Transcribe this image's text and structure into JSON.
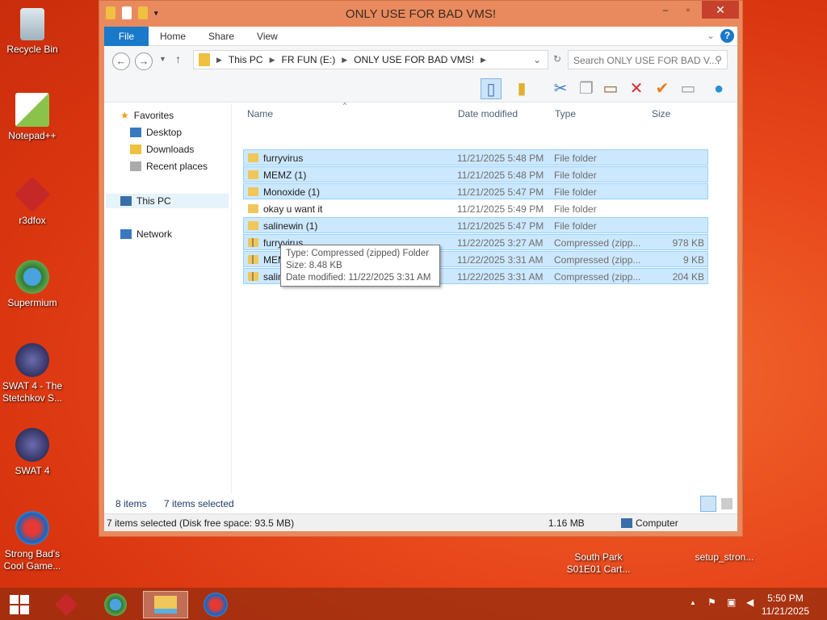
{
  "desktop": {
    "icons": [
      {
        "label": "Recycle Bin",
        "icon": "recycle-bin-icon"
      },
      {
        "label": "Notepad++",
        "icon": "notepad-icon"
      },
      {
        "label": "r3dfox",
        "icon": "r3dfox-icon"
      },
      {
        "label": "Supermium",
        "icon": "supermium-icon"
      },
      {
        "label": "SWAT 4 - The Stetchkov S...",
        "icon": "swat-icon"
      },
      {
        "label": "SWAT 4",
        "icon": "swat-icon"
      },
      {
        "label": "Strong Bad's Cool Game...",
        "icon": "strongbad-icon"
      },
      {
        "label": "South Park S01E01 Cart...",
        "icon": "video-icon"
      },
      {
        "label": "setup_stron...",
        "icon": "installer-icon"
      }
    ]
  },
  "window": {
    "title": "ONLY USE FOR BAD VMS!",
    "ribbon_tabs": [
      "File",
      "Home",
      "Share",
      "View"
    ],
    "breadcrumb": [
      "This PC",
      "FR FUN (E:)",
      "ONLY USE FOR BAD VMS!"
    ],
    "search_placeholder": "Search ONLY USE FOR BAD V...",
    "nav": {
      "favorites": "Favorites",
      "desktop": "Desktop",
      "downloads": "Downloads",
      "recent": "Recent places",
      "thispc": "This PC",
      "network": "Network"
    },
    "columns": [
      "Name",
      "Date modified",
      "Type",
      "Size"
    ],
    "files": [
      {
        "name": "furryvirus",
        "date": "11/21/2025 5:48 PM",
        "type": "File folder",
        "size": "",
        "selected": true,
        "zip": false
      },
      {
        "name": "MEMZ (1)",
        "date": "11/21/2025 5:48 PM",
        "type": "File folder",
        "size": "",
        "selected": true,
        "zip": false
      },
      {
        "name": "Monoxide (1)",
        "date": "11/21/2025 5:47 PM",
        "type": "File folder",
        "size": "",
        "selected": true,
        "zip": false
      },
      {
        "name": "okay u want it",
        "date": "11/21/2025 5:49 PM",
        "type": "File folder",
        "size": "",
        "selected": false,
        "zip": false
      },
      {
        "name": "salinewin (1)",
        "date": "11/21/2025 5:47 PM",
        "type": "File folder",
        "size": "",
        "selected": true,
        "zip": false
      },
      {
        "name": "furryvirus",
        "date": "11/22/2025 3:27 AM",
        "type": "Compressed (zipp...",
        "size": "978 KB",
        "selected": true,
        "zip": true
      },
      {
        "name": "MEMZ (1)",
        "date": "11/22/2025 3:31 AM",
        "type": "Compressed (zipp...",
        "size": "9 KB",
        "selected": true,
        "zip": true
      },
      {
        "name": "salinewin (1)",
        "date": "11/22/2025 3:31 AM",
        "type": "Compressed (zipp...",
        "size": "204 KB",
        "selected": true,
        "zip": true
      }
    ],
    "tooltip": {
      "type": "Type: Compressed (zipped) Folder",
      "size": "Size: 8.48 KB",
      "date": "Date modified: 11/22/2025 3:31 AM"
    },
    "status": {
      "items": "8 items",
      "selected": "7 items selected",
      "bar": "7 items selected (Disk free space: 93.5 MB)",
      "total": "1.16 MB",
      "location": "Computer"
    }
  },
  "taskbar": {
    "time": "5:50 PM",
    "date": "11/21/2025"
  }
}
